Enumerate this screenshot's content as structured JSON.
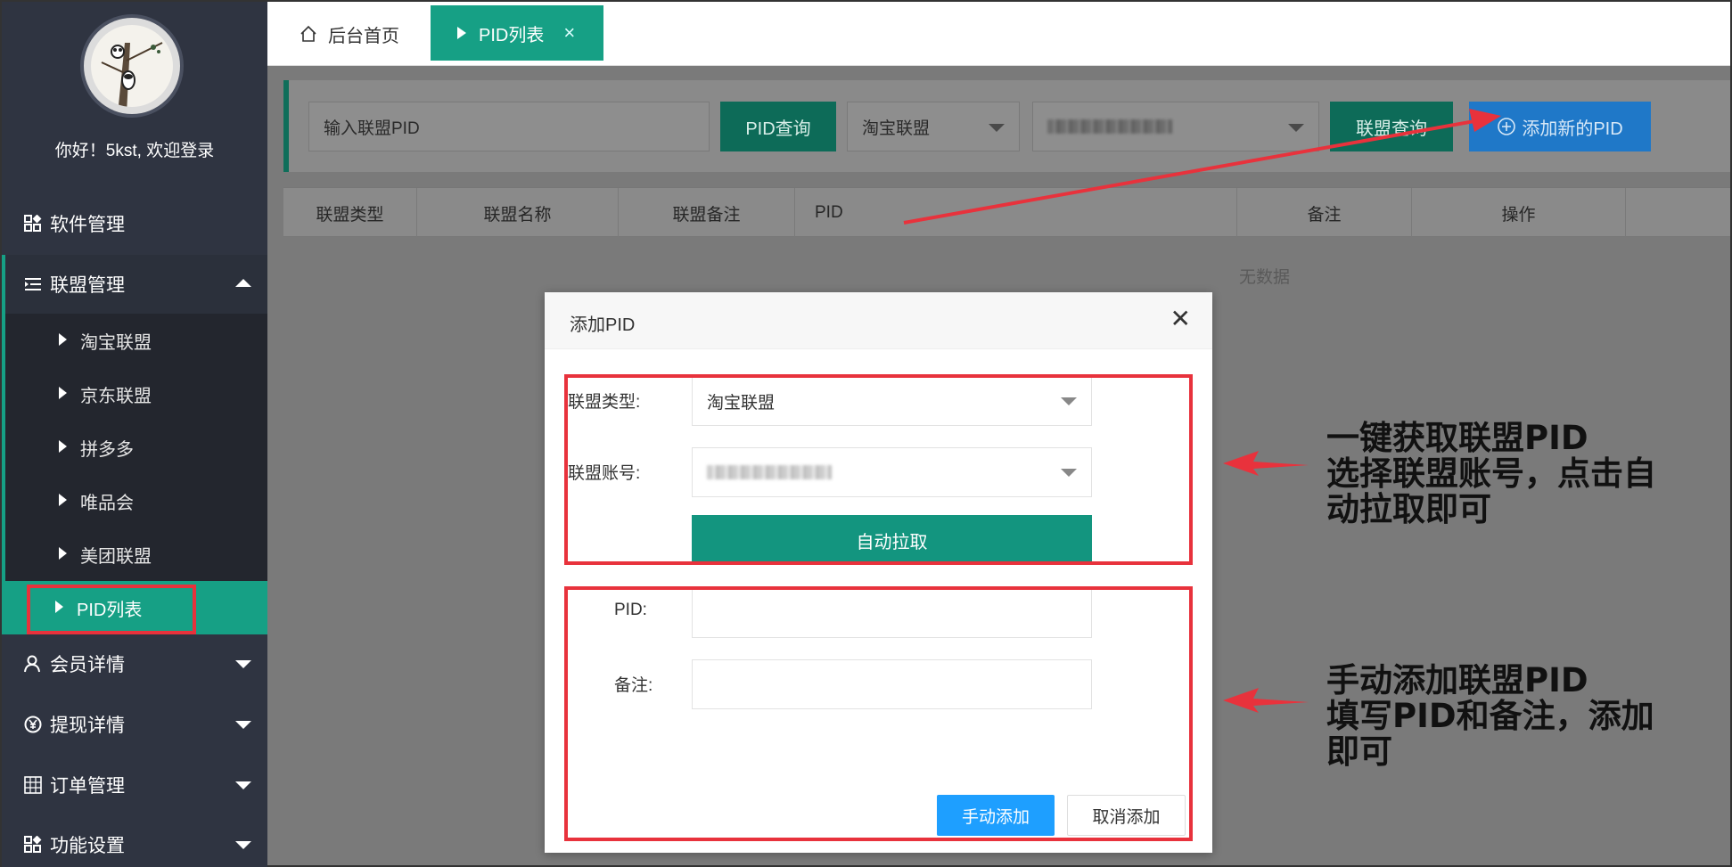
{
  "sidebar": {
    "welcome": "你好！5kst, 欢迎登录",
    "nav": [
      {
        "label": "软件管理",
        "icon": "apps-icon"
      },
      {
        "label": "联盟管理",
        "icon": "list-icon"
      },
      {
        "label": "会员详情",
        "icon": "user-icon"
      },
      {
        "label": "提现详情",
        "icon": "yen-icon"
      },
      {
        "label": "订单管理",
        "icon": "grid-icon"
      },
      {
        "label": "功能设置",
        "icon": "apps-icon"
      }
    ],
    "sub_items": [
      "淘宝联盟",
      "京东联盟",
      "拼多多",
      "唯品会",
      "美团联盟",
      "PID列表"
    ]
  },
  "tabs": {
    "home": "后台首页",
    "active": "PID列表",
    "close": "×"
  },
  "search": {
    "pid_placeholder": "输入联盟PID",
    "pid_query": "PID查询",
    "union_select": "淘宝联盟",
    "union_query": "联盟查询",
    "add_new": "添加新的PID"
  },
  "table": {
    "headers": [
      "联盟类型",
      "联盟名称",
      "联盟备注",
      "PID",
      "备注",
      "操作"
    ],
    "empty": "无数据"
  },
  "modal": {
    "title": "添加PID",
    "close": "✕",
    "union_type_label": "联盟类型:",
    "union_type_value": "淘宝联盟",
    "account_label": "联盟账号:",
    "auto_pull": "自动拉取",
    "pid_label": "PID:",
    "remark_label": "备注:",
    "manual_add": "手动添加",
    "cancel_add": "取消添加"
  },
  "annotations": {
    "auto": [
      "一键获取联盟PID",
      "选择联盟账号，点击自",
      "动拉取即可"
    ],
    "manual": [
      "手动添加联盟PID",
      "填写PID和备注，添加",
      "即可"
    ]
  },
  "colors": {
    "sidebar_bg": "#2f3441",
    "accent_teal": "#16a085",
    "annotation_red": "#e8323c",
    "primary_blue": "#1e9fff"
  }
}
